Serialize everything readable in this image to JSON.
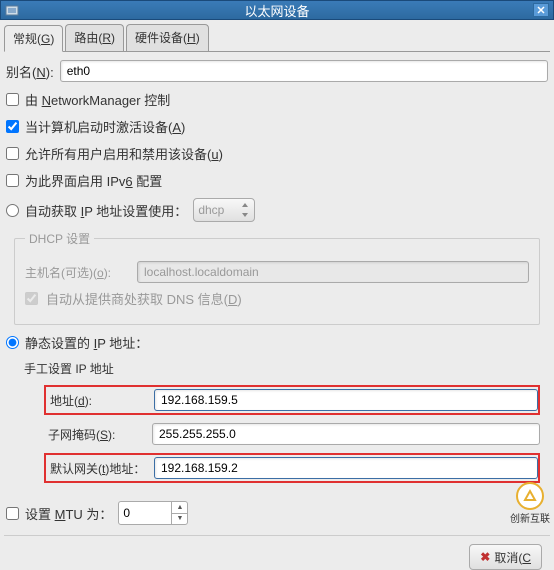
{
  "window": {
    "title": "以太网设备"
  },
  "tabs": {
    "general": {
      "label_pre": "常规(",
      "key": "G",
      "label_post": ")"
    },
    "route": {
      "label_pre": "路由(",
      "key": "R",
      "label_post": ")"
    },
    "hardware": {
      "label_pre": "硬件设备(",
      "key": "H",
      "label_post": ")"
    }
  },
  "alias": {
    "label_pre": "别名(",
    "key": "N",
    "label_post": "):",
    "value": "eth0"
  },
  "checks": {
    "nm": {
      "pre": "由 ",
      "key": "N",
      "post": "etworkManager 控制"
    },
    "activate": {
      "pre": "当计算机启动时激活设备(",
      "key": "A",
      "post": ")"
    },
    "allowusers": {
      "pre": "允许所有用户启用和禁用该设备(",
      "key": "u",
      "post": ")"
    },
    "ipv6": {
      "pre": "为此界面启用 IPv",
      "key": "6",
      "post": " 配置"
    }
  },
  "auto_ip": {
    "pre": "自动获取 ",
    "key": "I",
    "post": "P 地址设置使用：",
    "combo": "dhcp"
  },
  "dhcp_box": {
    "legend": "DHCP 设置",
    "hostname": {
      "label_pre": "主机名(可选)(",
      "key": "o",
      "label_post": "):",
      "value": "localhost.localdomain"
    },
    "autodns": {
      "pre": "自动从提供商处获取 DNS 信息(",
      "key": "D",
      "post": ")"
    }
  },
  "static": {
    "radio_pre": "静态设置的 ",
    "key": "I",
    "radio_post": "P 地址：",
    "legend": "手工设置 IP 地址",
    "addr": {
      "label_pre": "地址(",
      "key": "d",
      "label_post": "):",
      "value": "192.168.159.5"
    },
    "mask": {
      "label_pre": "子网掩码(",
      "key": "S",
      "label_post": "):",
      "value": "255.255.255.0"
    },
    "gw": {
      "label_pre": "默认网关(",
      "key": "t",
      "label_post": ")地址：",
      "value": "192.168.159.2"
    }
  },
  "mtu": {
    "pre": "设置 ",
    "key": "M",
    "post": "TU 为：",
    "value": "0"
  },
  "buttons": {
    "cancel": {
      "icon": "✖",
      "pre": "取消(",
      "key": "C"
    }
  },
  "watermark": "创新互联"
}
